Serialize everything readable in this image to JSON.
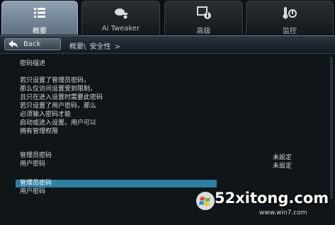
{
  "tabs": [
    {
      "label": "概要",
      "icon": "list-icon",
      "active": true
    },
    {
      "label": "Ai Tweaker",
      "icon": "tweaker-icon",
      "active": false
    },
    {
      "label": "高级",
      "icon": "info-icon",
      "active": false
    },
    {
      "label": "监控",
      "icon": "monitor-icon",
      "active": false
    }
  ],
  "nav": {
    "back_label": "Back",
    "breadcrumb_root": "概要\\",
    "breadcrumb_current": "安全性",
    "breadcrumb_arrow": ">"
  },
  "description": {
    "heading": "密码描述",
    "lines": [
      "若只设置了管理员密码，",
      "那么仅访问设置受到限制，",
      "且只在进入设置时需要此密码",
      "若只设置了用户密码，那么",
      "必须输入密码才能",
      "启动或进入设置。用户可以",
      "拥有管理权限"
    ]
  },
  "status": [
    {
      "label": "管理员密码",
      "value": "未設定"
    },
    {
      "label": "用户密码",
      "value": "未設定"
    }
  ],
  "options": [
    {
      "label": "管理员密码",
      "selected": true
    },
    {
      "label": "用户密码",
      "selected": false
    }
  ],
  "watermark": {
    "main": "52xitong.com",
    "sub": "www.win7.com"
  },
  "colors": {
    "selected_row": "#2f7fa3",
    "active_tab": "#8fa1b2"
  }
}
